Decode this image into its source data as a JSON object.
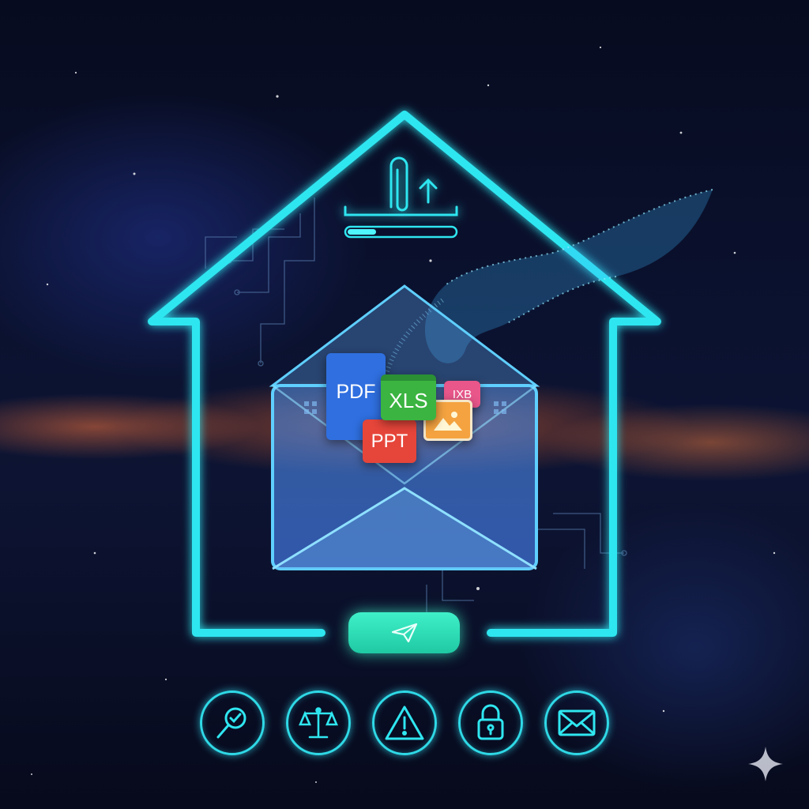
{
  "files": {
    "pdf_label": "PDF",
    "xls_label": "XLS",
    "ppt_label": "PPT",
    "small_label": "IXB"
  },
  "icons": {
    "upload": "paperclip-upload-icon",
    "send": "paper-plane-icon",
    "row": [
      "search-check-icon",
      "scales-icon",
      "warning-icon",
      "padlock-icon",
      "mail-icon"
    ],
    "watermark": "sparkle-icon"
  },
  "upload_progress": 0.27,
  "colors": {
    "neon": "#2fe6f0",
    "send": "#2fe0b8",
    "pdf": "#2f6fe0",
    "xls": "#3bb441",
    "ppt": "#e6453a",
    "image": "#f4a340"
  }
}
